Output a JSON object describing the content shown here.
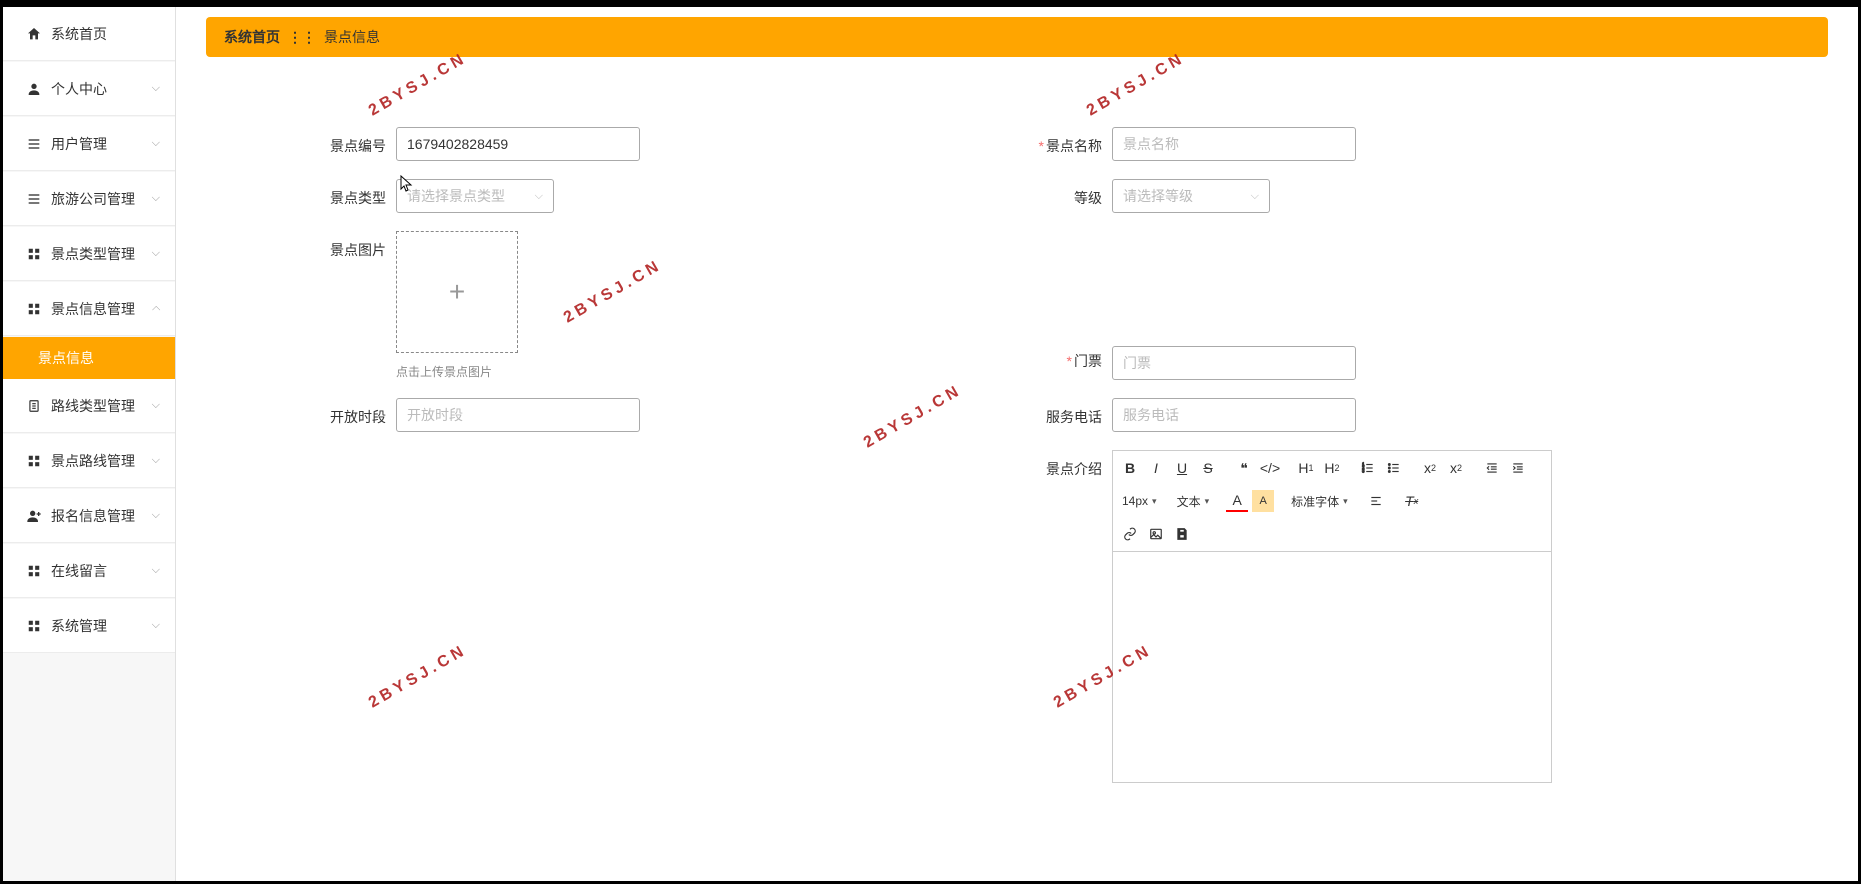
{
  "sidebar": {
    "items": [
      {
        "label": "系统首页",
        "icon": "home"
      },
      {
        "label": "个人中心",
        "icon": "user",
        "expandable": true
      },
      {
        "label": "用户管理",
        "icon": "list",
        "expandable": true
      },
      {
        "label": "旅游公司管理",
        "icon": "list",
        "expandable": true
      },
      {
        "label": "景点类型管理",
        "icon": "grid",
        "expandable": true
      },
      {
        "label": "景点信息管理",
        "icon": "grid",
        "expandable": true,
        "open": true
      },
      {
        "label": "路线类型管理",
        "icon": "clipboard",
        "expandable": true
      },
      {
        "label": "景点路线管理",
        "icon": "grid",
        "expandable": true
      },
      {
        "label": "报名信息管理",
        "icon": "user-add",
        "expandable": true
      },
      {
        "label": "在线留言",
        "icon": "grid",
        "expandable": true
      },
      {
        "label": "系统管理",
        "icon": "grid",
        "expandable": true
      }
    ],
    "subitem": "景点信息"
  },
  "breadcrumb": {
    "home": "系统首页",
    "current": "景点信息"
  },
  "form": {
    "id_label": "景点编号",
    "id_value": "1679402828459",
    "name_label": "景点名称",
    "name_placeholder": "景点名称",
    "type_label": "景点类型",
    "type_placeholder": "请选择景点类型",
    "level_label": "等级",
    "level_placeholder": "请选择等级",
    "image_label": "景点图片",
    "image_hint": "点击上传景点图片",
    "ticket_label": "门票",
    "ticket_placeholder": "门票",
    "hours_label": "开放时段",
    "hours_placeholder": "开放时段",
    "phone_label": "服务电话",
    "phone_placeholder": "服务电话",
    "intro_label": "景点介绍"
  },
  "editor": {
    "fontsize": "14px",
    "format": "文本",
    "fontfamily": "标准字体"
  },
  "watermark": "2BYSJ.CN"
}
